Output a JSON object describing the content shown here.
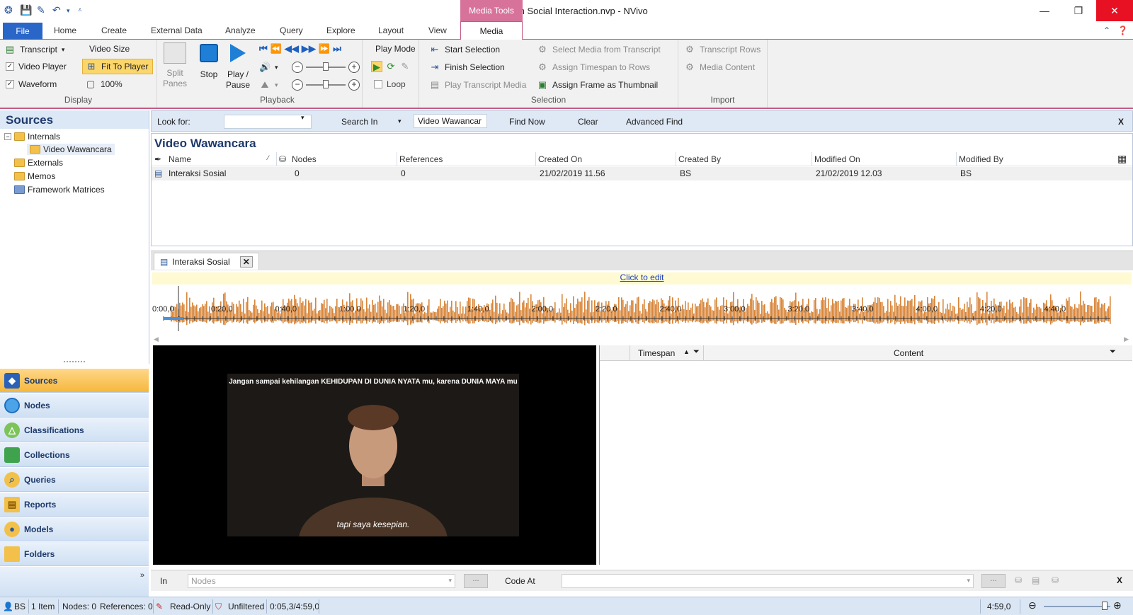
{
  "window": {
    "title": "Research Social Interaction.nvp - NVivo",
    "context_tab_header": "Media Tools",
    "minimize": "—",
    "restore": "❐",
    "close": "✕"
  },
  "ribbon_tabs": [
    "File",
    "Home",
    "Create",
    "External Data",
    "Analyze",
    "Query",
    "Explore",
    "Layout",
    "View",
    "Media"
  ],
  "ribbon": {
    "display": {
      "label": "Display",
      "transcript": "Transcript",
      "video_player": "Video Player",
      "waveform": "Waveform",
      "video_size": "Video Size",
      "fit_to_player": "Fit To Player",
      "zoom": "100%",
      "split_panes_l1": "Split",
      "split_panes_l2": "Panes"
    },
    "playback": {
      "label": "Playback",
      "stop": "Stop",
      "play_pause_l1": "Play /",
      "play_pause_l2": "Pause"
    },
    "play_mode": {
      "label": "Play Mode",
      "loop": "Loop"
    },
    "selection": {
      "label": "Selection",
      "start_selection": "Start Selection",
      "finish_selection": "Finish Selection",
      "play_transcript_media": "Play Transcript Media",
      "select_media_from_transcript": "Select Media from Transcript",
      "assign_timespan": "Assign Timespan to Rows",
      "assign_frame": "Assign Frame as Thumbnail"
    },
    "import": {
      "label": "Import",
      "transcript_rows": "Transcript Rows",
      "media_content": "Media Content"
    }
  },
  "sources_pane": {
    "title": "Sources",
    "tree": {
      "internals": "Internals",
      "video_wawancara": "Video Wawancara",
      "externals": "Externals",
      "memos": "Memos",
      "framework_matrices": "Framework Matrices"
    }
  },
  "nav": [
    "Sources",
    "Nodes",
    "Classifications",
    "Collections",
    "Queries",
    "Reports",
    "Models",
    "Folders"
  ],
  "findbar": {
    "look_for_label": "Look for:",
    "search_in_label": "Search In",
    "search_in_value": "Video Wawancar",
    "find_now": "Find Now",
    "clear": "Clear",
    "advanced_find": "Advanced Find",
    "close": "X"
  },
  "list": {
    "title": "Video Wawancara",
    "columns": [
      "Name",
      "Nodes",
      "References",
      "Created On",
      "Created By",
      "Modified On",
      "Modified By"
    ],
    "rows": [
      {
        "name": "Interaksi Sosial",
        "nodes": "0",
        "references": "0",
        "created_on": "21/02/2019 11.56",
        "created_by": "BS",
        "modified_on": "21/02/2019 12.03",
        "modified_by": "BS"
      }
    ]
  },
  "detail": {
    "tab_label": "Interaksi Sosial",
    "click_to_edit": "Click to edit",
    "timeline_ticks": [
      "0:00,0",
      "0:20,0",
      "0:40,0",
      "1:00,0",
      "1:20,0",
      "1:40,0",
      "2:00,0",
      "2:20,0",
      "2:40,0",
      "3:00,0",
      "3:20,0",
      "3:40,0",
      "4:00,0",
      "4:20,0",
      "4:40,0"
    ],
    "video_caption_top": "Jangan sampai kehilangan KEHIDUPAN DI DUNIA NYATA mu, karena DUNIA MAYA mu",
    "video_caption_bottom": "tapi saya kesepian.",
    "transcript_columns": [
      "Timespan",
      "Content"
    ]
  },
  "coding_bar": {
    "in_label": "In",
    "nodes_placeholder": "Nodes",
    "code_at_label": "Code At",
    "dots": "...",
    "close": "X"
  },
  "status_bar": {
    "user": "BS",
    "items": "1 Item",
    "nodes": "Nodes: 0",
    "references": "References: 0",
    "read_only": "Read-Only",
    "unfiltered": "Unfiltered",
    "position": "0:05,3/4:59,0",
    "duration": "4:59,0"
  },
  "colors": {
    "accent_pink": "#d7739b",
    "file_tab_blue": "#2a66c8",
    "waveform_orange": "#d8863a",
    "nav_active": "#f6b73c",
    "title_navy": "#1e3a6b"
  }
}
